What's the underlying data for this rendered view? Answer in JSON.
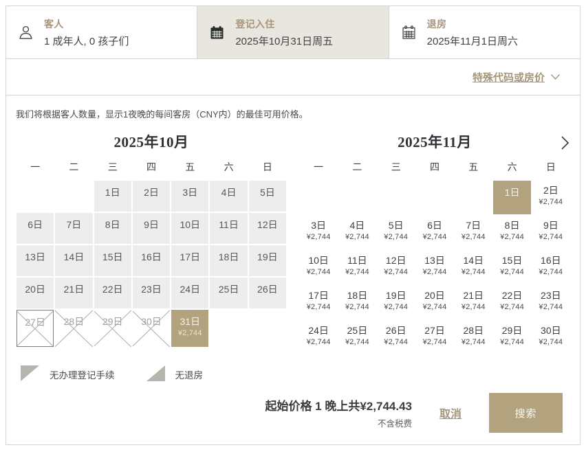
{
  "colors": {
    "accent_tan": "#b2a27d",
    "tan_text": "#a6957b",
    "active_tab_bg": "#e9e6df",
    "disabled_cell_bg": "#ededed"
  },
  "header": {
    "guests": {
      "label": "客人",
      "value": "1 成年人, 0 孩子们"
    },
    "checkin": {
      "label": "登记入住",
      "value": "2025年10月31日周五"
    },
    "checkout": {
      "label": "退房",
      "value": "2025年11月1日周六"
    }
  },
  "special_link_label": "特殊代码或房价",
  "description": "我们将根据客人数量，显示1夜晚的每间客房（CNY内）的最佳可用价格。",
  "weekdays": [
    "一",
    "二",
    "三",
    "四",
    "五",
    "六",
    "日"
  ],
  "calendars": [
    {
      "title": "2025年10月",
      "rows": [
        [
          {
            "t": "empty"
          },
          {
            "t": "empty"
          },
          {
            "d": "1日",
            "t": "past"
          },
          {
            "d": "2日",
            "t": "past"
          },
          {
            "d": "3日",
            "t": "past"
          },
          {
            "d": "4日",
            "t": "past"
          },
          {
            "d": "5日",
            "t": "past"
          }
        ],
        [
          {
            "d": "6日",
            "t": "past"
          },
          {
            "d": "7日",
            "t": "past"
          },
          {
            "d": "8日",
            "t": "past"
          },
          {
            "d": "9日",
            "t": "past"
          },
          {
            "d": "10日",
            "t": "past"
          },
          {
            "d": "11日",
            "t": "past"
          },
          {
            "d": "12日",
            "t": "past"
          }
        ],
        [
          {
            "d": "13日",
            "t": "past"
          },
          {
            "d": "14日",
            "t": "past"
          },
          {
            "d": "15日",
            "t": "past"
          },
          {
            "d": "16日",
            "t": "past"
          },
          {
            "d": "17日",
            "t": "past"
          },
          {
            "d": "18日",
            "t": "past"
          },
          {
            "d": "19日",
            "t": "past"
          }
        ],
        [
          {
            "d": "20日",
            "t": "past"
          },
          {
            "d": "21日",
            "t": "past"
          },
          {
            "d": "22日",
            "t": "past"
          },
          {
            "d": "23日",
            "t": "past"
          },
          {
            "d": "24日",
            "t": "past"
          },
          {
            "d": "25日",
            "t": "past"
          },
          {
            "d": "26日",
            "t": "past"
          }
        ],
        [
          {
            "d": "27日",
            "t": "crossed",
            "b": true
          },
          {
            "d": "28日",
            "t": "crossed"
          },
          {
            "d": "29日",
            "t": "crossed"
          },
          {
            "d": "30日",
            "t": "crossed"
          },
          {
            "d": "31日",
            "t": "selected",
            "p": "¥2,744"
          },
          {
            "t": "empty"
          },
          {
            "t": "empty"
          }
        ]
      ]
    },
    {
      "title": "2025年11月",
      "has_next_arrow": true,
      "rows": [
        [
          {
            "t": "empty"
          },
          {
            "t": "empty"
          },
          {
            "t": "empty"
          },
          {
            "t": "empty"
          },
          {
            "t": "empty"
          },
          {
            "d": "1日",
            "t": "selected"
          },
          {
            "d": "2日",
            "t": "open",
            "p": "¥2,744"
          }
        ],
        [
          {
            "d": "3日",
            "t": "open",
            "p": "¥2,744"
          },
          {
            "d": "4日",
            "t": "open",
            "p": "¥2,744"
          },
          {
            "d": "5日",
            "t": "open",
            "p": "¥2,744"
          },
          {
            "d": "6日",
            "t": "open",
            "p": "¥2,744"
          },
          {
            "d": "7日",
            "t": "open",
            "p": "¥2,744"
          },
          {
            "d": "8日",
            "t": "open",
            "p": "¥2,744"
          },
          {
            "d": "9日",
            "t": "open",
            "p": "¥2,744"
          }
        ],
        [
          {
            "d": "10日",
            "t": "open",
            "p": "¥2,744"
          },
          {
            "d": "11日",
            "t": "open",
            "p": "¥2,744"
          },
          {
            "d": "12日",
            "t": "open",
            "p": "¥2,744"
          },
          {
            "d": "13日",
            "t": "open",
            "p": "¥2,744"
          },
          {
            "d": "14日",
            "t": "open",
            "p": "¥2,744"
          },
          {
            "d": "15日",
            "t": "open",
            "p": "¥2,744"
          },
          {
            "d": "16日",
            "t": "open",
            "p": "¥2,744"
          }
        ],
        [
          {
            "d": "17日",
            "t": "open",
            "p": "¥2,744"
          },
          {
            "d": "18日",
            "t": "open",
            "p": "¥2,744"
          },
          {
            "d": "19日",
            "t": "open",
            "p": "¥2,744"
          },
          {
            "d": "20日",
            "t": "open",
            "p": "¥2,744"
          },
          {
            "d": "21日",
            "t": "open",
            "p": "¥2,744"
          },
          {
            "d": "22日",
            "t": "open",
            "p": "¥2,744"
          },
          {
            "d": "23日",
            "t": "open",
            "p": "¥2,744"
          }
        ],
        [
          {
            "d": "24日",
            "t": "open",
            "p": "¥2,744"
          },
          {
            "d": "25日",
            "t": "open",
            "p": "¥2,744"
          },
          {
            "d": "26日",
            "t": "open",
            "p": "¥2,744"
          },
          {
            "d": "27日",
            "t": "open",
            "p": "¥2,744"
          },
          {
            "d": "28日",
            "t": "open",
            "p": "¥2,744"
          },
          {
            "d": "29日",
            "t": "open",
            "p": "¥2,744"
          },
          {
            "d": "30日",
            "t": "open",
            "p": "¥2,744"
          }
        ]
      ]
    }
  ],
  "legend": [
    {
      "icon": "no-checkin-triangle",
      "label": "无办理登记手续"
    },
    {
      "icon": "no-checkout-triangle",
      "label": "无退房"
    }
  ],
  "footer": {
    "price_summary": "起始价格 1 晚上共¥2,744.43",
    "tax_note": "不含税费",
    "cancel_label": "取消",
    "search_label": "搜索"
  }
}
